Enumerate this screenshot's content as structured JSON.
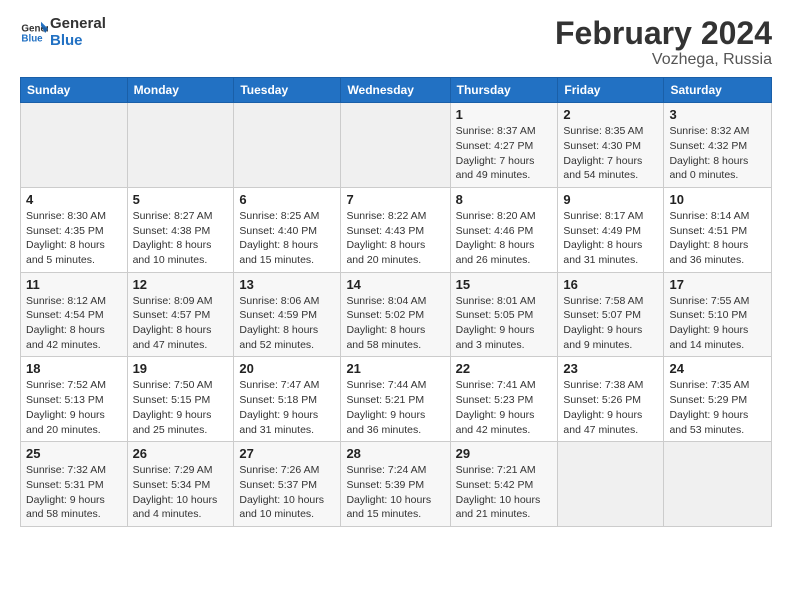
{
  "header": {
    "logo_line1": "General",
    "logo_line2": "Blue",
    "month_year": "February 2024",
    "location": "Vozhega, Russia"
  },
  "columns": [
    "Sunday",
    "Monday",
    "Tuesday",
    "Wednesday",
    "Thursday",
    "Friday",
    "Saturday"
  ],
  "weeks": [
    [
      {
        "day": "",
        "info": ""
      },
      {
        "day": "",
        "info": ""
      },
      {
        "day": "",
        "info": ""
      },
      {
        "day": "",
        "info": ""
      },
      {
        "day": "1",
        "info": "Sunrise: 8:37 AM\nSunset: 4:27 PM\nDaylight: 7 hours\nand 49 minutes."
      },
      {
        "day": "2",
        "info": "Sunrise: 8:35 AM\nSunset: 4:30 PM\nDaylight: 7 hours\nand 54 minutes."
      },
      {
        "day": "3",
        "info": "Sunrise: 8:32 AM\nSunset: 4:32 PM\nDaylight: 8 hours\nand 0 minutes."
      }
    ],
    [
      {
        "day": "4",
        "info": "Sunrise: 8:30 AM\nSunset: 4:35 PM\nDaylight: 8 hours\nand 5 minutes."
      },
      {
        "day": "5",
        "info": "Sunrise: 8:27 AM\nSunset: 4:38 PM\nDaylight: 8 hours\nand 10 minutes."
      },
      {
        "day": "6",
        "info": "Sunrise: 8:25 AM\nSunset: 4:40 PM\nDaylight: 8 hours\nand 15 minutes."
      },
      {
        "day": "7",
        "info": "Sunrise: 8:22 AM\nSunset: 4:43 PM\nDaylight: 8 hours\nand 20 minutes."
      },
      {
        "day": "8",
        "info": "Sunrise: 8:20 AM\nSunset: 4:46 PM\nDaylight: 8 hours\nand 26 minutes."
      },
      {
        "day": "9",
        "info": "Sunrise: 8:17 AM\nSunset: 4:49 PM\nDaylight: 8 hours\nand 31 minutes."
      },
      {
        "day": "10",
        "info": "Sunrise: 8:14 AM\nSunset: 4:51 PM\nDaylight: 8 hours\nand 36 minutes."
      }
    ],
    [
      {
        "day": "11",
        "info": "Sunrise: 8:12 AM\nSunset: 4:54 PM\nDaylight: 8 hours\nand 42 minutes."
      },
      {
        "day": "12",
        "info": "Sunrise: 8:09 AM\nSunset: 4:57 PM\nDaylight: 8 hours\nand 47 minutes."
      },
      {
        "day": "13",
        "info": "Sunrise: 8:06 AM\nSunset: 4:59 PM\nDaylight: 8 hours\nand 52 minutes."
      },
      {
        "day": "14",
        "info": "Sunrise: 8:04 AM\nSunset: 5:02 PM\nDaylight: 8 hours\nand 58 minutes."
      },
      {
        "day": "15",
        "info": "Sunrise: 8:01 AM\nSunset: 5:05 PM\nDaylight: 9 hours\nand 3 minutes."
      },
      {
        "day": "16",
        "info": "Sunrise: 7:58 AM\nSunset: 5:07 PM\nDaylight: 9 hours\nand 9 minutes."
      },
      {
        "day": "17",
        "info": "Sunrise: 7:55 AM\nSunset: 5:10 PM\nDaylight: 9 hours\nand 14 minutes."
      }
    ],
    [
      {
        "day": "18",
        "info": "Sunrise: 7:52 AM\nSunset: 5:13 PM\nDaylight: 9 hours\nand 20 minutes."
      },
      {
        "day": "19",
        "info": "Sunrise: 7:50 AM\nSunset: 5:15 PM\nDaylight: 9 hours\nand 25 minutes."
      },
      {
        "day": "20",
        "info": "Sunrise: 7:47 AM\nSunset: 5:18 PM\nDaylight: 9 hours\nand 31 minutes."
      },
      {
        "day": "21",
        "info": "Sunrise: 7:44 AM\nSunset: 5:21 PM\nDaylight: 9 hours\nand 36 minutes."
      },
      {
        "day": "22",
        "info": "Sunrise: 7:41 AM\nSunset: 5:23 PM\nDaylight: 9 hours\nand 42 minutes."
      },
      {
        "day": "23",
        "info": "Sunrise: 7:38 AM\nSunset: 5:26 PM\nDaylight: 9 hours\nand 47 minutes."
      },
      {
        "day": "24",
        "info": "Sunrise: 7:35 AM\nSunset: 5:29 PM\nDaylight: 9 hours\nand 53 minutes."
      }
    ],
    [
      {
        "day": "25",
        "info": "Sunrise: 7:32 AM\nSunset: 5:31 PM\nDaylight: 9 hours\nand 58 minutes."
      },
      {
        "day": "26",
        "info": "Sunrise: 7:29 AM\nSunset: 5:34 PM\nDaylight: 10 hours\nand 4 minutes."
      },
      {
        "day": "27",
        "info": "Sunrise: 7:26 AM\nSunset: 5:37 PM\nDaylight: 10 hours\nand 10 minutes."
      },
      {
        "day": "28",
        "info": "Sunrise: 7:24 AM\nSunset: 5:39 PM\nDaylight: 10 hours\nand 15 minutes."
      },
      {
        "day": "29",
        "info": "Sunrise: 7:21 AM\nSunset: 5:42 PM\nDaylight: 10 hours\nand 21 minutes."
      },
      {
        "day": "",
        "info": ""
      },
      {
        "day": "",
        "info": ""
      }
    ]
  ]
}
